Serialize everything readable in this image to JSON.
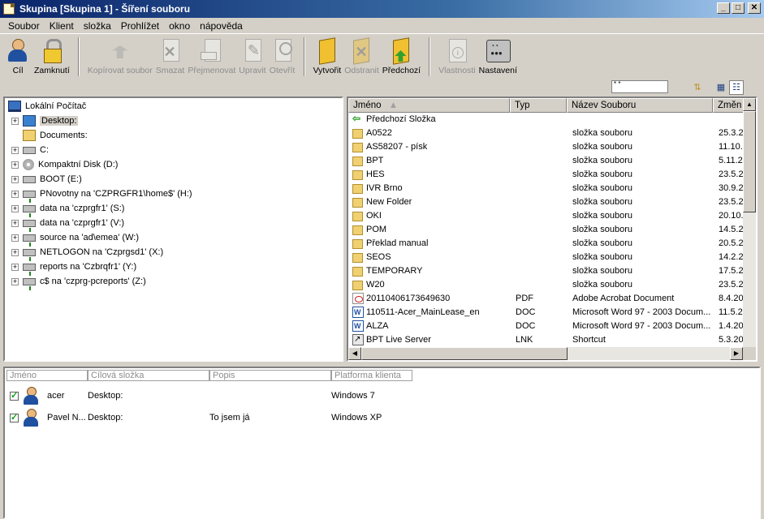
{
  "window": {
    "title": "Skupina [Skupina 1] - Šíření souboru",
    "controls": [
      "_",
      "□",
      "✕"
    ]
  },
  "menu": [
    "Soubor",
    "Klient",
    "složka",
    "Prohlížet",
    "okno",
    "nápověda"
  ],
  "toolbar": {
    "cil": "Cíl",
    "zamknuti": "Zamknutí",
    "kopirovat": "Kopírovat soubor",
    "smazat": "Smazat",
    "prejmenovat": "Přejmenovat",
    "upravit": "Upravit",
    "otevrit": "Otevřít",
    "vytvorit": "Vytvořit",
    "odstranit": "Odstranit",
    "predchozi": "Předchozí",
    "vlastnosti": "Vlastnosti",
    "nastaveni": "Nastavení"
  },
  "address": {
    "value": "* *"
  },
  "tree": {
    "root": "Lokální Počítač",
    "items": [
      {
        "label": "Desktop:",
        "icon": "desktop-icon"
      },
      {
        "label": "Documents:",
        "icon": "folder-icon"
      },
      {
        "label": "C:",
        "icon": "drive-icon"
      },
      {
        "label": "Kompaktní Disk (D:)",
        "icon": "cd-drive-icon"
      },
      {
        "label": "BOOT (E:)",
        "icon": "drive-icon"
      },
      {
        "label": "PNovotny na 'CZPRGFR1\\home$' (H:)",
        "icon": "network-drive-icon"
      },
      {
        "label": "data na 'czprgfr1' (S:)",
        "icon": "network-drive-icon"
      },
      {
        "label": "data na 'czprgfr1' (V:)",
        "icon": "network-drive-icon"
      },
      {
        "label": "source na 'ad\\emea' (W:)",
        "icon": "network-drive-icon"
      },
      {
        "label": "NETLOGON na 'Czprgsd1' (X:)",
        "icon": "network-drive-icon"
      },
      {
        "label": "reports na 'Czbrqfr1' (Y:)",
        "icon": "network-drive-icon"
      },
      {
        "label": "c$ na 'czprg-pcreports' (Z:)",
        "icon": "network-drive-icon"
      }
    ]
  },
  "files": {
    "columns": [
      "Jméno",
      "Typ",
      "Název Souboru",
      "Změn"
    ],
    "rows": [
      {
        "name": "Předchozí Složka",
        "type": "",
        "desc": "",
        "date": "",
        "icon": "back"
      },
      {
        "name": "A0522",
        "type": "",
        "desc": "složka souboru",
        "date": "25.3.2",
        "icon": "folder"
      },
      {
        "name": "AS58207 - písk",
        "type": "",
        "desc": "složka souboru",
        "date": "11.10.",
        "icon": "folder"
      },
      {
        "name": "BPT",
        "type": "",
        "desc": "složka souboru",
        "date": "5.11.2",
        "icon": "folder"
      },
      {
        "name": "HES",
        "type": "",
        "desc": "složka souboru",
        "date": "23.5.2",
        "icon": "folder"
      },
      {
        "name": "IVR Brno",
        "type": "",
        "desc": "složka souboru",
        "date": "30.9.2",
        "icon": "folder"
      },
      {
        "name": "New Folder",
        "type": "",
        "desc": "složka souboru",
        "date": "23.5.2",
        "icon": "folder"
      },
      {
        "name": "OKI",
        "type": "",
        "desc": "složka souboru",
        "date": "20.10.",
        "icon": "folder"
      },
      {
        "name": "POM",
        "type": "",
        "desc": "složka souboru",
        "date": "14.5.2",
        "icon": "folder"
      },
      {
        "name": "Překlad manual",
        "type": "",
        "desc": "složka souboru",
        "date": "20.5.2",
        "icon": "folder"
      },
      {
        "name": "SEOS",
        "type": "",
        "desc": "složka souboru",
        "date": "14.2.2",
        "icon": "folder"
      },
      {
        "name": "TEMPORARY",
        "type": "",
        "desc": "složka souboru",
        "date": "17.5.2",
        "icon": "folder"
      },
      {
        "name": "W20",
        "type": "",
        "desc": "složka souboru",
        "date": "23.5.2",
        "icon": "folder"
      },
      {
        "name": "20110406173649630",
        "type": "PDF",
        "desc": "Adobe Acrobat Document",
        "date": "8.4.20",
        "icon": "pdf"
      },
      {
        "name": "110511-Acer_MainLease_en",
        "type": "DOC",
        "desc": "Microsoft Word 97 - 2003 Docum...",
        "date": "11.5.2",
        "icon": "doc"
      },
      {
        "name": "ALZA",
        "type": "DOC",
        "desc": "Microsoft Word 97 - 2003 Docum...",
        "date": "1.4.20",
        "icon": "doc"
      },
      {
        "name": "BPT Live Server",
        "type": "LNK",
        "desc": "Shortcut",
        "date": "5.3.20",
        "icon": "lnk"
      }
    ]
  },
  "clients": {
    "columns": [
      "Jméno",
      "Cílová složka",
      "Popis",
      "Platforma klienta"
    ],
    "rows": [
      {
        "name": "acer",
        "target": "Desktop:",
        "desc": "",
        "platform": "Windows 7"
      },
      {
        "name": "Pavel N...",
        "target": "Desktop:",
        "desc": "To jsem já",
        "platform": "Windows XP"
      }
    ]
  }
}
